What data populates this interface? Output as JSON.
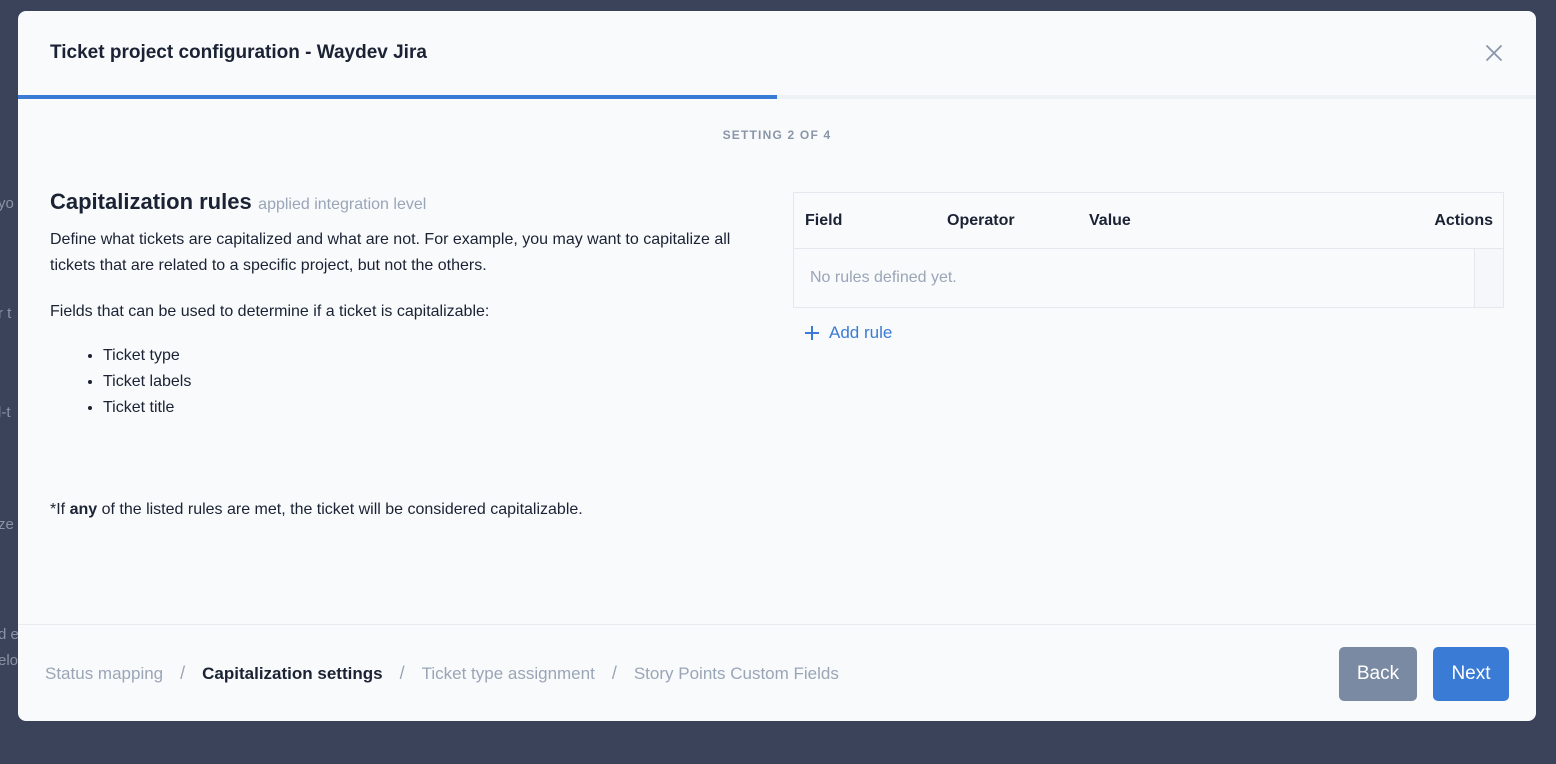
{
  "background_snippets": [
    "yo",
    "r t",
    "l-t",
    "ze",
    "d e",
    "elo"
  ],
  "modal": {
    "title": "Ticket project configuration - Waydev Jira",
    "progress_fraction": 0.5,
    "step_label": "SETTING 2 OF 4"
  },
  "section": {
    "title": "Capitalization rules",
    "subtitle": "applied integration level",
    "description": "Define what tickets are capitalized and what are not. For example, you may want to capitalize all tickets that are related to a specific project, but not the others.",
    "fields_intro": "Fields that can be used to determine if a ticket is capitalizable:",
    "fields": [
      "Ticket type",
      "Ticket labels",
      "Ticket title"
    ],
    "footnote_prefix": "*If ",
    "footnote_emphasis": "any",
    "footnote_suffix": " of the listed rules are met, the ticket will be considered capitalizable."
  },
  "rules_table": {
    "columns": [
      "Field",
      "Operator",
      "Value",
      "Actions"
    ],
    "empty_message": "No rules defined yet."
  },
  "add_rule_label": "Add rule",
  "footer": {
    "breadcrumbs": [
      {
        "label": "Status mapping",
        "active": false
      },
      {
        "label": "Capitalization settings",
        "active": true
      },
      {
        "label": "Ticket type assignment",
        "active": false
      },
      {
        "label": "Story Points Custom Fields",
        "active": false
      }
    ],
    "separator": "/",
    "back_label": "Back",
    "next_label": "Next"
  },
  "colors": {
    "accent": "#3a7bd5",
    "overlay": "#3a4359",
    "muted_text": "#9aa5b6",
    "back_button": "#7b8aa3"
  }
}
